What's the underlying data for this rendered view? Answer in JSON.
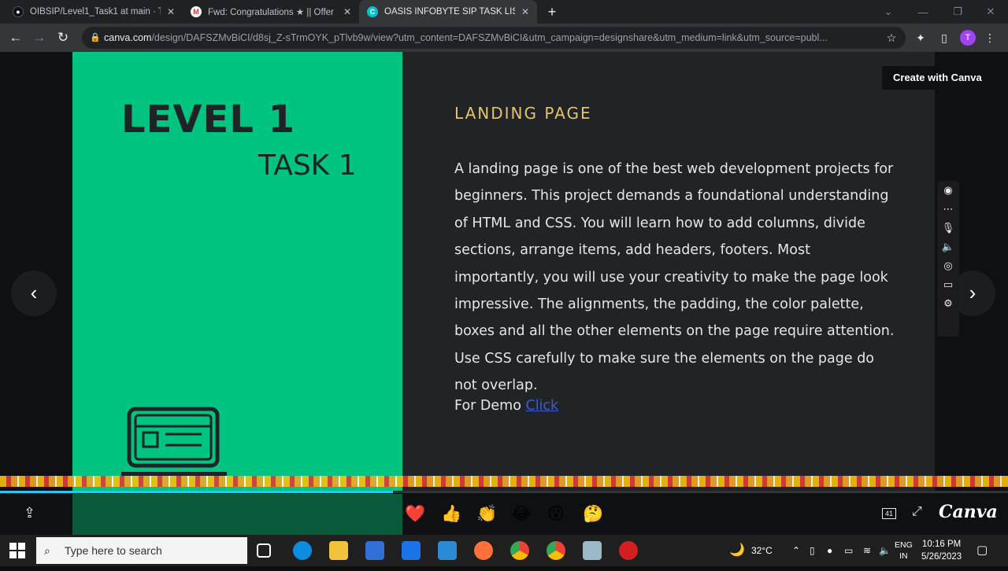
{
  "browser": {
    "tabs": [
      {
        "label": "OIBSIP/Level1_Task1 at main · Th",
        "favicon": "github-icon",
        "active": false
      },
      {
        "label": "Fwd: Congratulations ★ || Offer",
        "favicon": "gmail-icon",
        "active": false
      },
      {
        "label": "OASIS INFOBYTE SIP TASK LIST",
        "favicon": "canva-icon",
        "active": true
      }
    ],
    "url_host": "canva.com",
    "url_path": "/design/DAFSZMvBiCI/d8sj_Z-sTrmOYK_pTlvb9w/view?utm_content=DAFSZMvBiCI&utm_campaign=designshare&utm_medium=link&utm_source=publ...",
    "avatar_letter": "T"
  },
  "slide": {
    "level": "LEVEL 1",
    "task": "TASK 1",
    "section_title": "LANDING PAGE",
    "description": "A landing page is one of the best web development projects for beginners. This project demands a foundational understanding of HTML and CSS. You will learn how to add columns, divide sections, arrange items, add headers, footers. Most importantly, you will use your creativity to make the page look impressive. The alignments, the padding, the color palette, boxes and all the other elements on the page require attention. Use CSS carefully to make sure the elements on the page do not overlap.",
    "demo_label": "For Demo",
    "demo_link": "Click"
  },
  "canva": {
    "create_button": "Create with Canva",
    "brand": "Canva",
    "page_count": "41",
    "reactions": [
      "❤️",
      "👍",
      "👏",
      "😂",
      "😮",
      "🤔"
    ]
  },
  "taskbar": {
    "search_placeholder": "Type here to search",
    "weather": "32°C",
    "lang_top": "ENG",
    "lang_bottom": "IN",
    "time": "10:16 PM",
    "date": "5/26/2023"
  },
  "colors": {
    "slide_green": "#00c47f",
    "slide_dark": "#212427",
    "accent_gold": "#e5c36b",
    "link_blue": "#3b5bd9"
  }
}
